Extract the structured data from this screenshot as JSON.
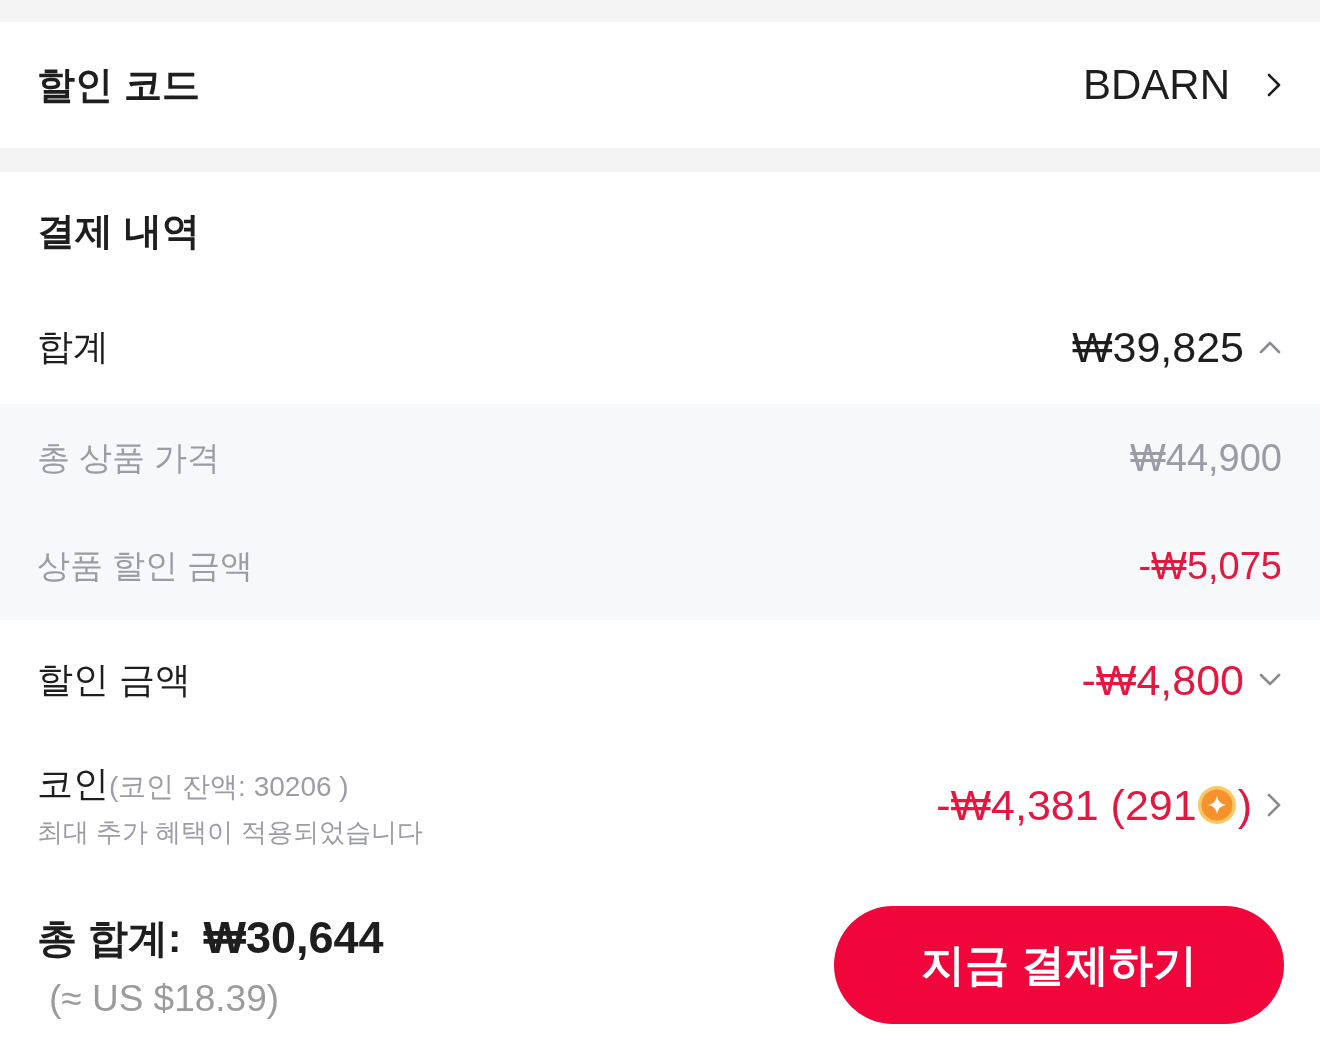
{
  "discount_code": {
    "label": "할인 코드",
    "value": "BDARN"
  },
  "payment_details": {
    "title": "결제 내역",
    "rows": [
      {
        "kind": "summary",
        "label": "합계",
        "value": "₩39,825",
        "negative": false,
        "expanded": true,
        "children": [
          {
            "label": "총 상품 가격",
            "value": "₩44,900",
            "negative": false
          },
          {
            "label": "상품 할인 금액",
            "value": "-₩5,075",
            "negative": true
          }
        ]
      },
      {
        "kind": "summary",
        "label": "할인 금액",
        "value": "-₩4,800",
        "negative": true,
        "expanded": false
      },
      {
        "kind": "coin",
        "label": "코인",
        "note": "(코인 잔액: 30206 )",
        "subtext": "최대 추가 혜택이 적용되었습니다",
        "value": "-₩4,381 (291",
        "value_end": ")",
        "negative": true
      }
    ]
  },
  "footer": {
    "total_label": "총 합계:",
    "total_value": "₩30,644",
    "converted_total": "(≈ US $18.39)",
    "pay_button": "지금 결제하기"
  }
}
